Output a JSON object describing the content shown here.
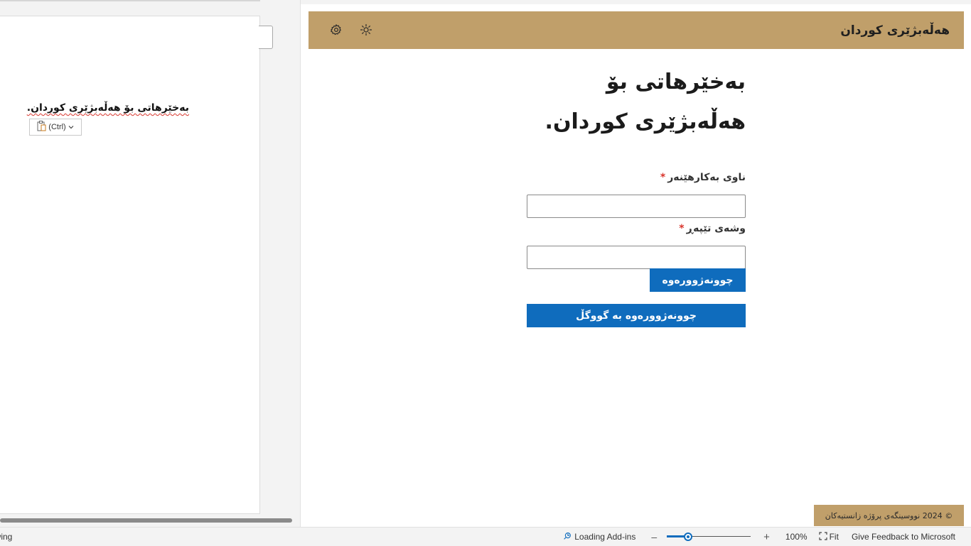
{
  "document": {
    "pasted_text": "بەخێرهاتی بۆ هەڵەبژێری کوردان.",
    "paste_options_label": "(Ctrl)"
  },
  "addin": {
    "header": {
      "title": "هەڵەبژێری کوردان",
      "icons": [
        "settings-gear-icon",
        "sun-theme-icon"
      ]
    },
    "welcome_heading": "بەخێرهاتی بۆ هەڵەبژێری کوردان.",
    "form": {
      "username_label": "ناوی بەکارهێنەر",
      "username_value": "",
      "password_label": "وشەی تێپەڕ",
      "password_value": "",
      "required_marker": "*",
      "login_button": "چوونەژوورەوە",
      "google_login_button": "چوونەژوورەوە بە گووگڵ"
    },
    "footer": "© 2024 نووسینگەی پرۆژە زانستیەکان",
    "colors": {
      "brand": "#c09f6a",
      "primary_button": "#0f6cbd",
      "required": "#d9352c"
    }
  },
  "statusbar": {
    "left_text": "owing",
    "loading_addins": "Loading Add-ins",
    "zoom_out": "–",
    "zoom_in": "+",
    "zoom_percent": "100%",
    "zoom_level": 0.25,
    "fit_label": "Fit",
    "feedback": "Give Feedback to Microsoft"
  }
}
